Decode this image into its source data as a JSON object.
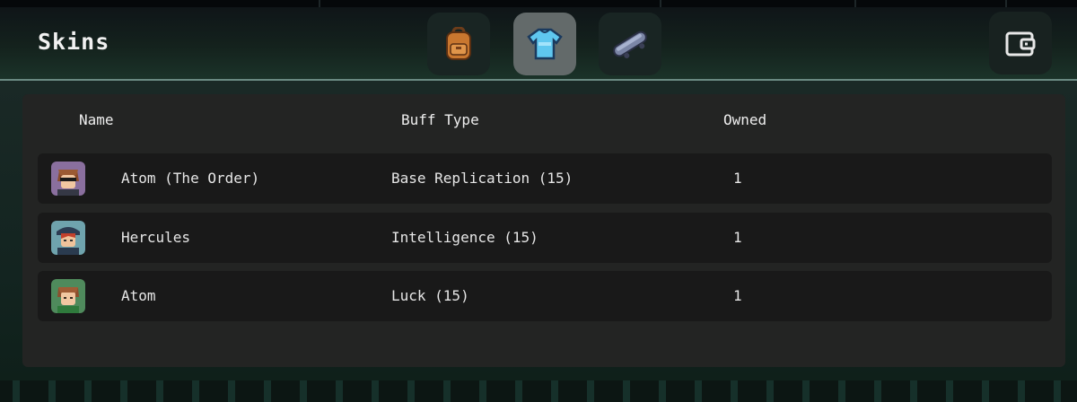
{
  "header": {
    "title": "Skins",
    "tabs": [
      {
        "icon": "backpack-icon",
        "active": false
      },
      {
        "icon": "shirt-icon",
        "active": true
      },
      {
        "icon": "skateboard-icon",
        "active": false
      }
    ],
    "wallet_icon": "wallet-icon"
  },
  "table": {
    "columns": {
      "name": "Name",
      "buff": "Buff Type",
      "owned": "Owned"
    },
    "rows": [
      {
        "name": "Atom (The Order)",
        "buff": "Base Replication (15)",
        "owned": "1",
        "avatar_bg": "#8a6f9e"
      },
      {
        "name": "Hercules",
        "buff": "Intelligence (15)",
        "owned": "1",
        "avatar_bg": "#6fa3ad"
      },
      {
        "name": "Atom",
        "buff": "Luck (15)",
        "owned": "1",
        "avatar_bg": "#4f8a5c"
      }
    ]
  },
  "colors": {
    "panel": "#232423",
    "row": "#191919",
    "active_tab": "#636a6a",
    "accent_line": "#6a8a82"
  }
}
